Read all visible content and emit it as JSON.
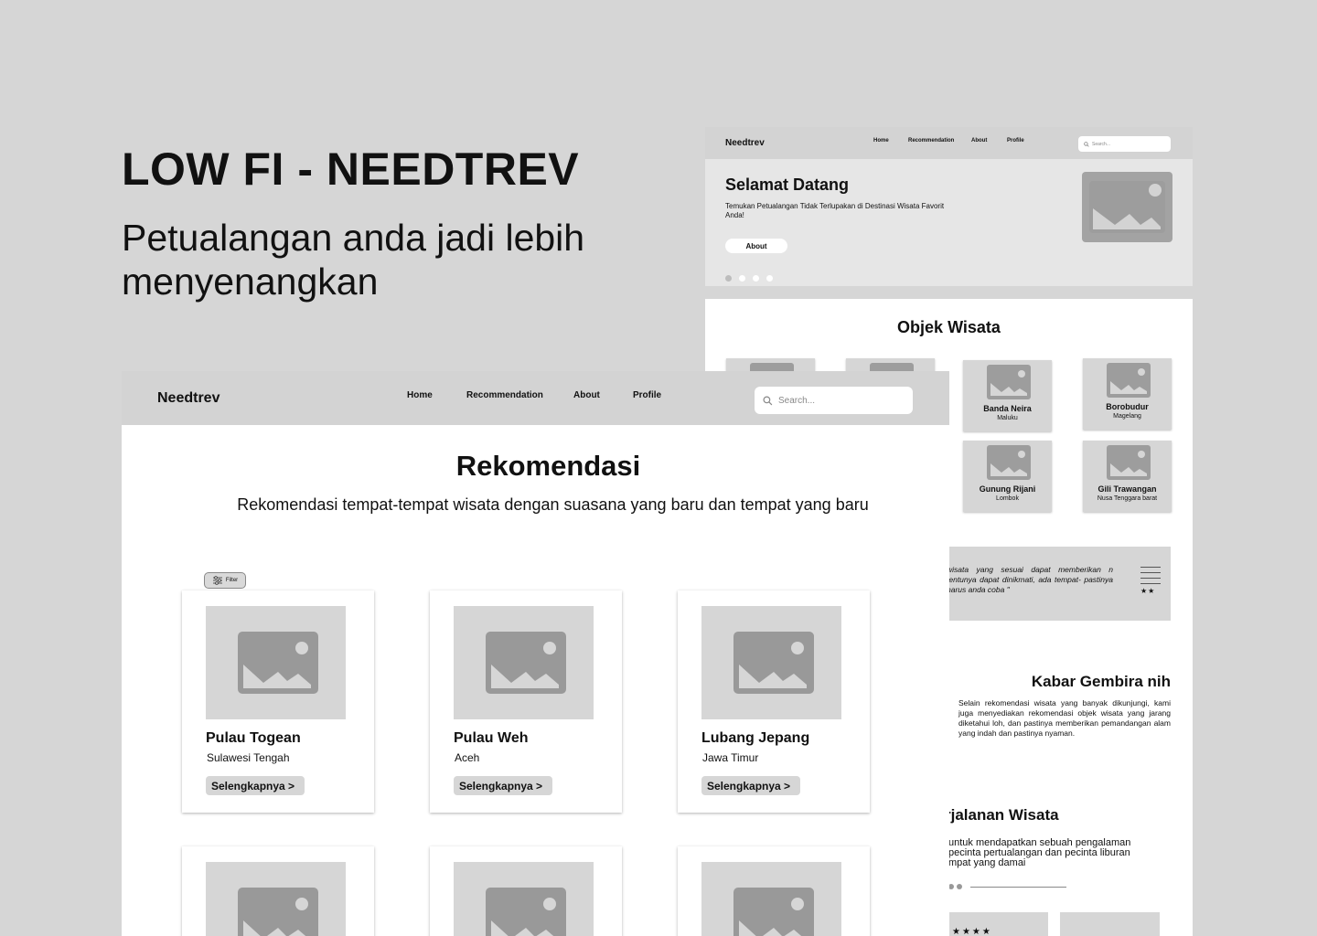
{
  "presentation": {
    "title": "LOW FI - NEEDTREV",
    "subtitle": "Petualangan anda jadi lebih menyenangkan"
  },
  "home_wireframe": {
    "nav": {
      "logo": "Needtrev",
      "links": [
        "Home",
        "Recommendation",
        "About",
        "Profile"
      ],
      "search_placeholder": "Search..."
    },
    "hero": {
      "title": "Selamat Datang",
      "description": "Temukan Petualangan Tidak Terlupakan di Destinasi Wisata Favorit Anda!",
      "button": "About"
    },
    "objek": {
      "title": "Objek Wisata",
      "cards": [
        {
          "name": "Banda Neira",
          "location": "Maluku"
        },
        {
          "name": "Borobudur",
          "location": "Magelang"
        },
        {
          "name": "Gunung Rijani",
          "location": "Lombok"
        },
        {
          "name": "Gili Trawangan",
          "location": "Nusa Tenggara barat"
        }
      ]
    },
    "quote": {
      "text": "wisata yang sesuai dapat memberikan n tentunya dapat dinikmati, ada tempat- pastinya harus anda coba \"",
      "stars": "★★"
    },
    "kabar": {
      "title": "Kabar Gembira nih",
      "text": "Selain rekomendasi wisata yang banyak dikunjungi, kami juga menyediakan rekomendasi objek wisata yang jarang diketahui loh, dan pastinya memberikan pemandangan alam yang indah dan pastinya nyaman."
    },
    "perjalanan": {
      "title": "rjalanan Wisata",
      "text": "untuk mendapatkan sebuah pengalaman pecinta pertualangan dan pecinta liburan mpat yang damai",
      "stars": "★★★★"
    }
  },
  "rekomendasi_wireframe": {
    "nav": {
      "logo": "Needtrev",
      "links": [
        "Home",
        "Recommendation",
        "About",
        "Profile"
      ],
      "search_placeholder": "Search..."
    },
    "title": "Rekomendasi",
    "description": "Rekomendasi tempat-tempat wisata dengan suasana yang baru dan tempat yang baru",
    "filter_label": "Filter",
    "cards": [
      {
        "name": "Pulau Togean",
        "location": "Sulawesi Tengah",
        "button": "Selengkapnya >"
      },
      {
        "name": "Pulau Weh",
        "location": "Aceh",
        "button": "Selengkapnya >"
      },
      {
        "name": "Lubang Jepang",
        "location": "Jawa Timur",
        "button": "Selengkapnya >"
      }
    ]
  }
}
